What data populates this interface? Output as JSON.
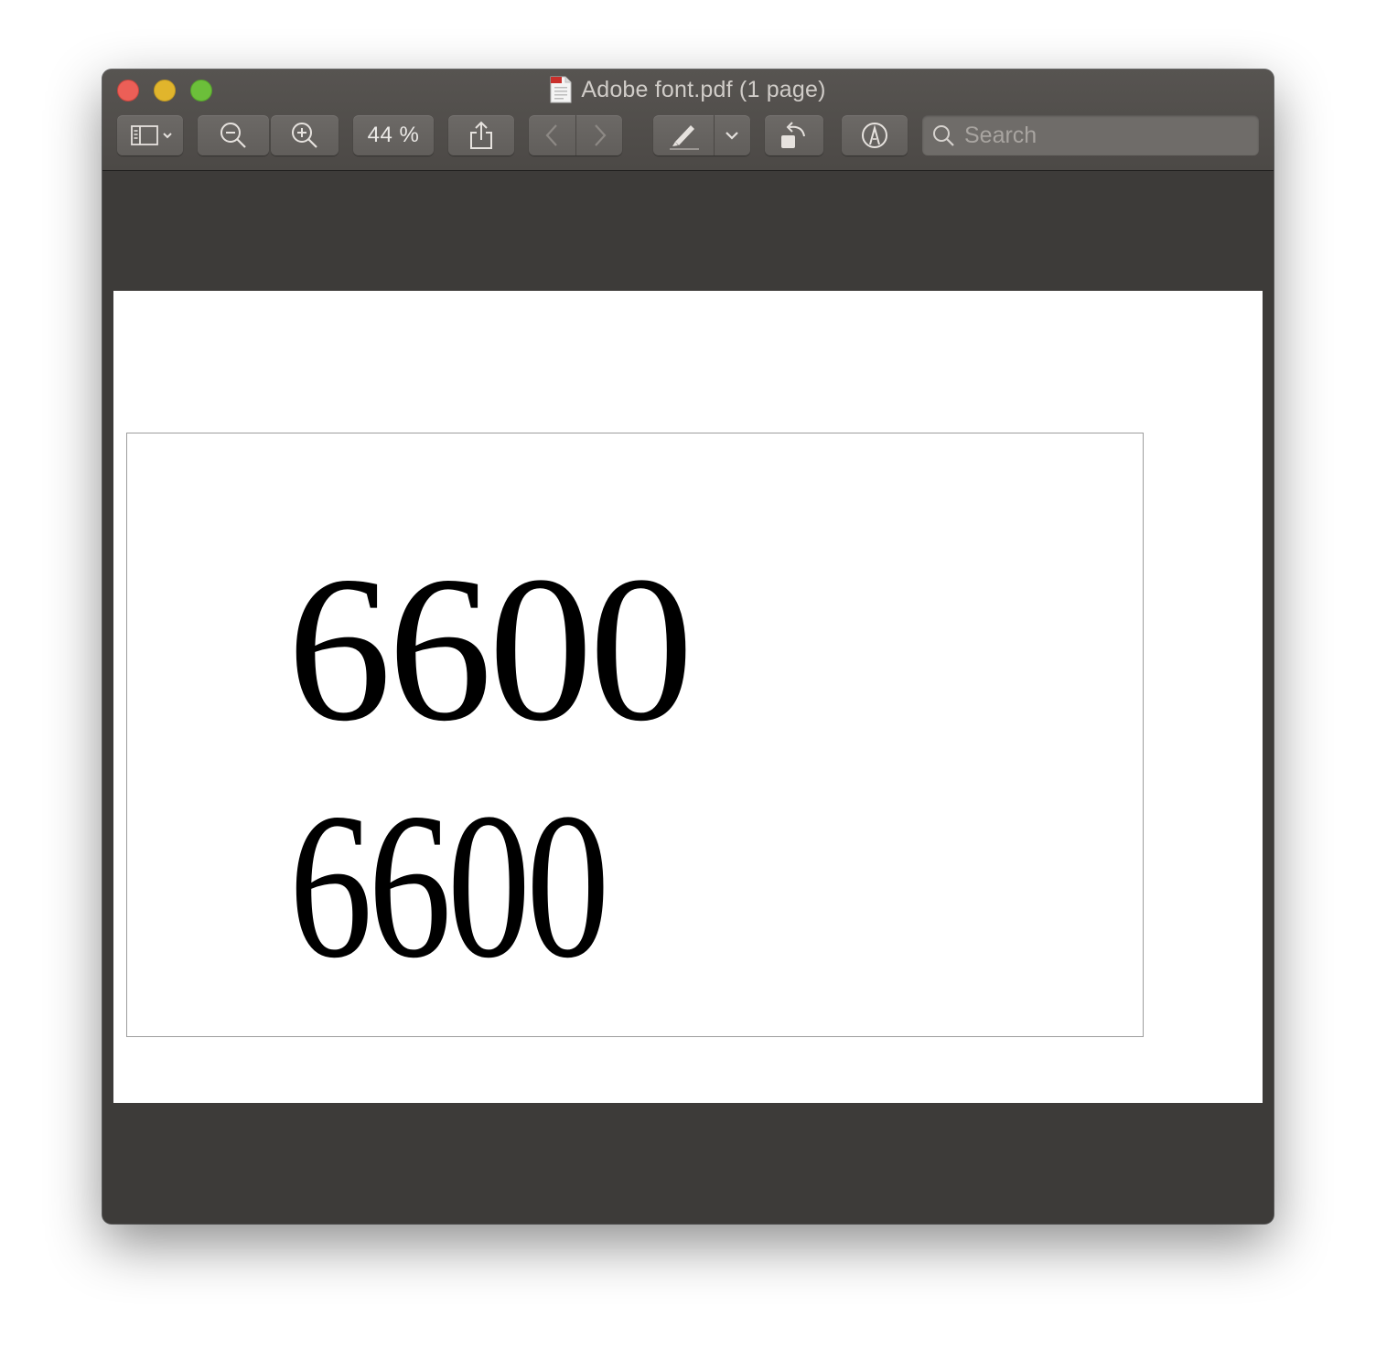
{
  "window": {
    "title": "Adobe font.pdf (1 page)",
    "traffic_lights": [
      "close",
      "minimize",
      "zoom"
    ]
  },
  "toolbar": {
    "sidebar_icon": "sidebar-icon",
    "zoom_out_icon": "zoom-out-icon",
    "zoom_in_icon": "zoom-in-icon",
    "zoom_level": "44 %",
    "share_icon": "share-icon",
    "prev_icon": "chevron-left-icon",
    "next_icon": "chevron-right-icon",
    "highlight_icon": "highlight-pen-icon",
    "rotate_icon": "rotate-left-icon",
    "markup_icon": "markup-icon",
    "search": {
      "placeholder": "Search",
      "value": ""
    }
  },
  "document": {
    "lines": [
      "6600",
      "6600"
    ]
  },
  "colors": {
    "window_bg": "#3d3b39",
    "toolbar_bg": "#4f4c49",
    "button_bg": "#666360",
    "close": "#ec5f57",
    "minimize": "#e1b52c",
    "zoom": "#6cbf3a",
    "page_bg": "#ffffff",
    "text": "#000000"
  }
}
